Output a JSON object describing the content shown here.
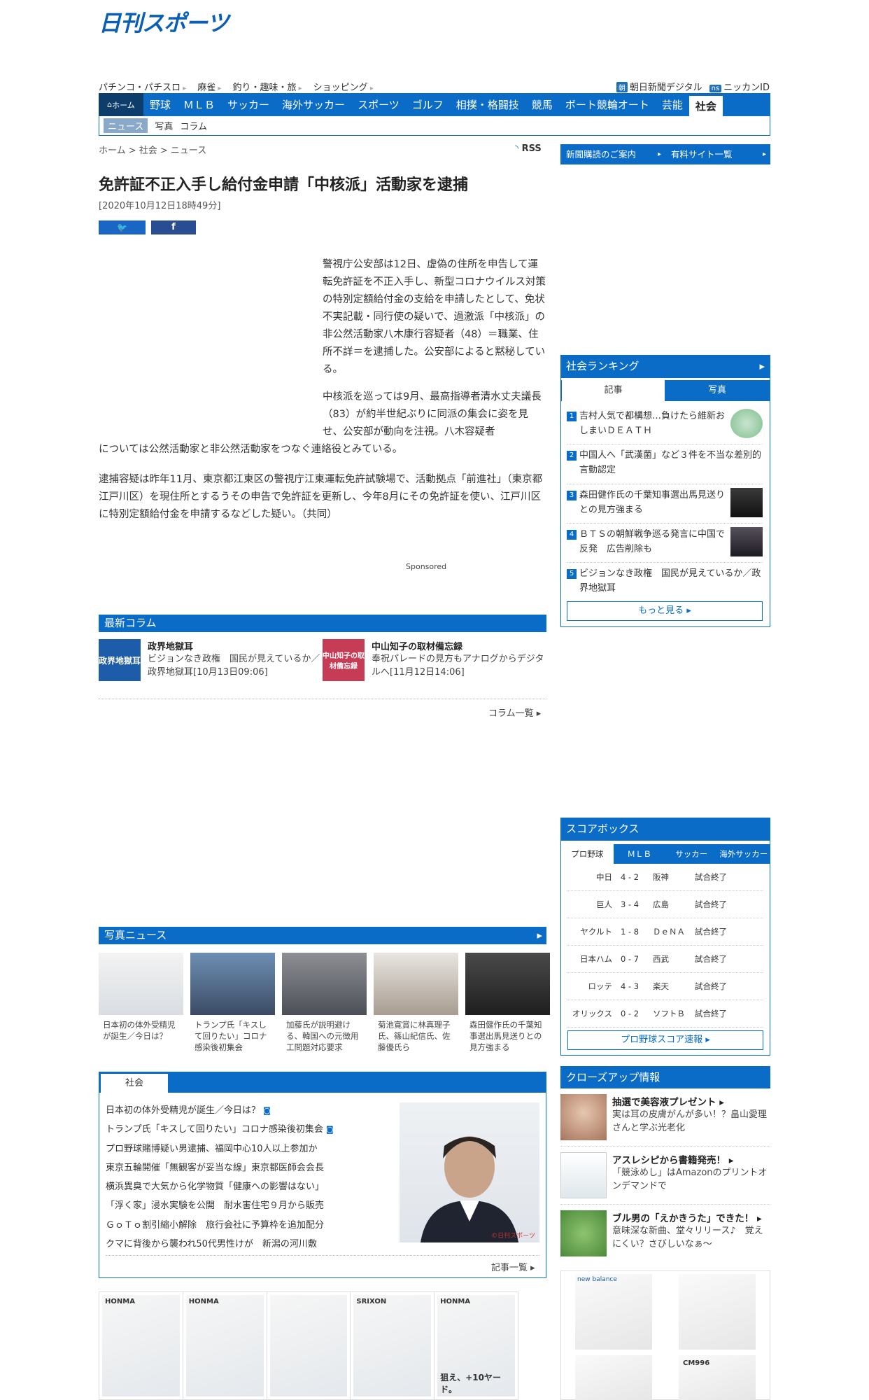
{
  "logo": "日刊スポーツ",
  "top_links": [
    "パチンコ・パチスロ",
    "麻雀",
    "釣り・趣味・旅",
    "ショッピング"
  ],
  "top_right_links": [
    {
      "badge": "朝",
      "label": "朝日新聞デジタル"
    },
    {
      "badge": "ns",
      "label": "ニッカンID"
    }
  ],
  "main_nav": {
    "home": "ホーム",
    "items": [
      "野球",
      "ＭＬＢ",
      "サッカー",
      "海外サッカー",
      "スポーツ",
      "ゴルフ",
      "相撲・格闘技",
      "競馬",
      "ボート競輪オート",
      "芸能",
      "社会"
    ]
  },
  "sub_nav": [
    "ニュース",
    "写真",
    "コラム"
  ],
  "breadcrumb": "ホーム > 社会 > ニュース",
  "rss": "RSS",
  "article": {
    "title": "免許証不正入手し給付金申請「中核派」活動家を逮捕",
    "date": "[2020年10月12日18時49分]",
    "share_fb": "f",
    "p1": "警視庁公安部は12日、虚偽の住所を申告して運転免許証を不正入手し、新型コロナウイルス対策の特別定額給付金の支給を申請したとして、免状不実記載・同行使の疑いで、過激派「中核派」の非公然活動家八木康行容疑者（48）＝職業、住所不詳＝を逮捕した。公安部によると黙秘している。",
    "p2": "中核派を巡っては9月、最高指導者清水丈夫議長（83）が約半世紀ぶりに同派の集会に姿を見せ、公安部が動向を注視。八木容疑者",
    "p3": "については公然活動家と非公然活動家をつなぐ連絡役とみている。",
    "p4": "逮捕容疑は昨年11月、東京都江東区の警視庁江東運転免許試験場で、活動拠点「前進社」（東京都江戸川区）を現住所とするうその申告で免許証を更新し、今年8月にその免許証を使い、江戸川区に特別定額給付金を申請するなどした疑い。（共同）",
    "sponsored": "Sponsored"
  },
  "columns": {
    "header": "最新コラム",
    "items": [
      {
        "thumb": "政界地獄耳",
        "title": "政界地獄耳",
        "desc": "ビジョンなき政権　国民が見えているか／政界地獄耳[10月13日09:06]"
      },
      {
        "thumb": "中山知子の取材備忘録",
        "title": "中山知子の取材備忘録",
        "desc": "奉祝パレードの見方もアナログからデジタルへ[11月12日14:06]"
      }
    ],
    "more": "コラム一覧"
  },
  "photo_news": {
    "header": "写真ニュース",
    "items": [
      {
        "caption": "日本初の体外受精児が誕生／今日は？"
      },
      {
        "caption": "トランプ氏「キスして回りたい」コロナ感染後初集会"
      },
      {
        "caption": "加藤氏が説明避ける、韓国への元徴用工問題対応要求"
      },
      {
        "caption": "菊池寛賞に林真理子氏、篠山紀信氏、佐藤優氏ら"
      },
      {
        "caption": "森田健作氏の千葉知事選出馬見送りとの見方強まる"
      }
    ]
  },
  "society": {
    "tab": "社会",
    "items": [
      {
        "text": "日本初の体外受精児が誕生／今日は？",
        "cam": true
      },
      {
        "text": "トランプ氏「キスして回りたい」コロナ感染後初集会",
        "cam": true
      },
      {
        "text": "プロ野球賭博疑い男逮捕、福岡中心10人以上参加か",
        "cam": false
      },
      {
        "text": "東京五輪開催「無観客が妥当な線」東京都医師会会長",
        "cam": false
      },
      {
        "text": "横浜異臭で大気から化学物質「健康への影響はない」",
        "cam": false
      },
      {
        "text": "「浮く家」浸水実験を公開　耐水害住宅９月から販売",
        "cam": false
      },
      {
        "text": "ＧｏＴｏ割引縮小解除　旅行会社に予算枠を追加配分",
        "cam": false
      },
      {
        "text": "クマに背後から襲われ50代男性けが　新潟の河川敷",
        "cam": false
      }
    ],
    "photo_credit": "©日刊スポーツ",
    "more": "記事一覧"
  },
  "right": {
    "btn1": "新聞購読のご案内",
    "btn2": "有料サイト一覧",
    "ranking": {
      "header": "社会ランキング",
      "tab1": "記事",
      "tab2": "写真",
      "items": [
        {
          "num": "1",
          "text": "吉村人気で都構想…負けたら維新おしまいＤＥＡＴＨ"
        },
        {
          "num": "2",
          "text": "中国人へ「武漢菌」など３件を不当な差別的言動認定"
        },
        {
          "num": "3",
          "text": "森田健作氏の千葉知事選出馬見送りとの見方強まる"
        },
        {
          "num": "4",
          "text": "ＢＴＳの朝鮮戦争巡る発言に中国で反発　広告削除も"
        },
        {
          "num": "5",
          "text": "ビジョンなき政権　国民が見えているか／政界地獄耳"
        }
      ],
      "more": "もっと見る"
    },
    "scorebox": {
      "header": "スコアボックス",
      "tabs": [
        "プロ野球",
        "ＭＬＢ",
        "サッカー",
        "海外サッカー"
      ],
      "games": [
        {
          "home": "中日",
          "score": "4 - 2",
          "away": "阪神",
          "status": "試合終了"
        },
        {
          "home": "巨人",
          "score": "3 - 4",
          "away": "広島",
          "status": "試合終了"
        },
        {
          "home": "ヤクルト",
          "score": "1 - 8",
          "away": "ＤｅＮＡ",
          "status": "試合終了"
        },
        {
          "home": "日本ハム",
          "score": "0 - 7",
          "away": "西武",
          "status": "試合終了"
        },
        {
          "home": "ロッテ",
          "score": "4 - 3",
          "away": "楽天",
          "status": "試合終了"
        },
        {
          "home": "オリックス",
          "score": "0 - 2",
          "away": "ソフトＢ",
          "status": "試合終了"
        }
      ],
      "more": "プロ野球スコア速報"
    },
    "closeup": {
      "header": "クローズアップ情報",
      "items": [
        {
          "title": "抽選で美容液プレゼント",
          "desc": "実は耳の皮膚がんが多い！？畠山愛理さんと学ぶ光老化"
        },
        {
          "title": "アスレシピから書籍発売！",
          "desc": "「競泳めし」はAmazonのプリントオンデマンドで"
        },
        {
          "title": "ブル男の「えかきうた」できた！",
          "desc": "意味深な新曲、堂々リリース♪　覚えにくい？さびしいなぁ～"
        }
      ]
    },
    "shoes": [
      "new balance",
      "",
      "",
      "CM996"
    ]
  },
  "ads": {
    "labels": [
      "HONMA",
      "HONMA",
      "",
      "SRIXON",
      "HONMA"
    ],
    "tagline": "狙え、+10ヤード。"
  }
}
